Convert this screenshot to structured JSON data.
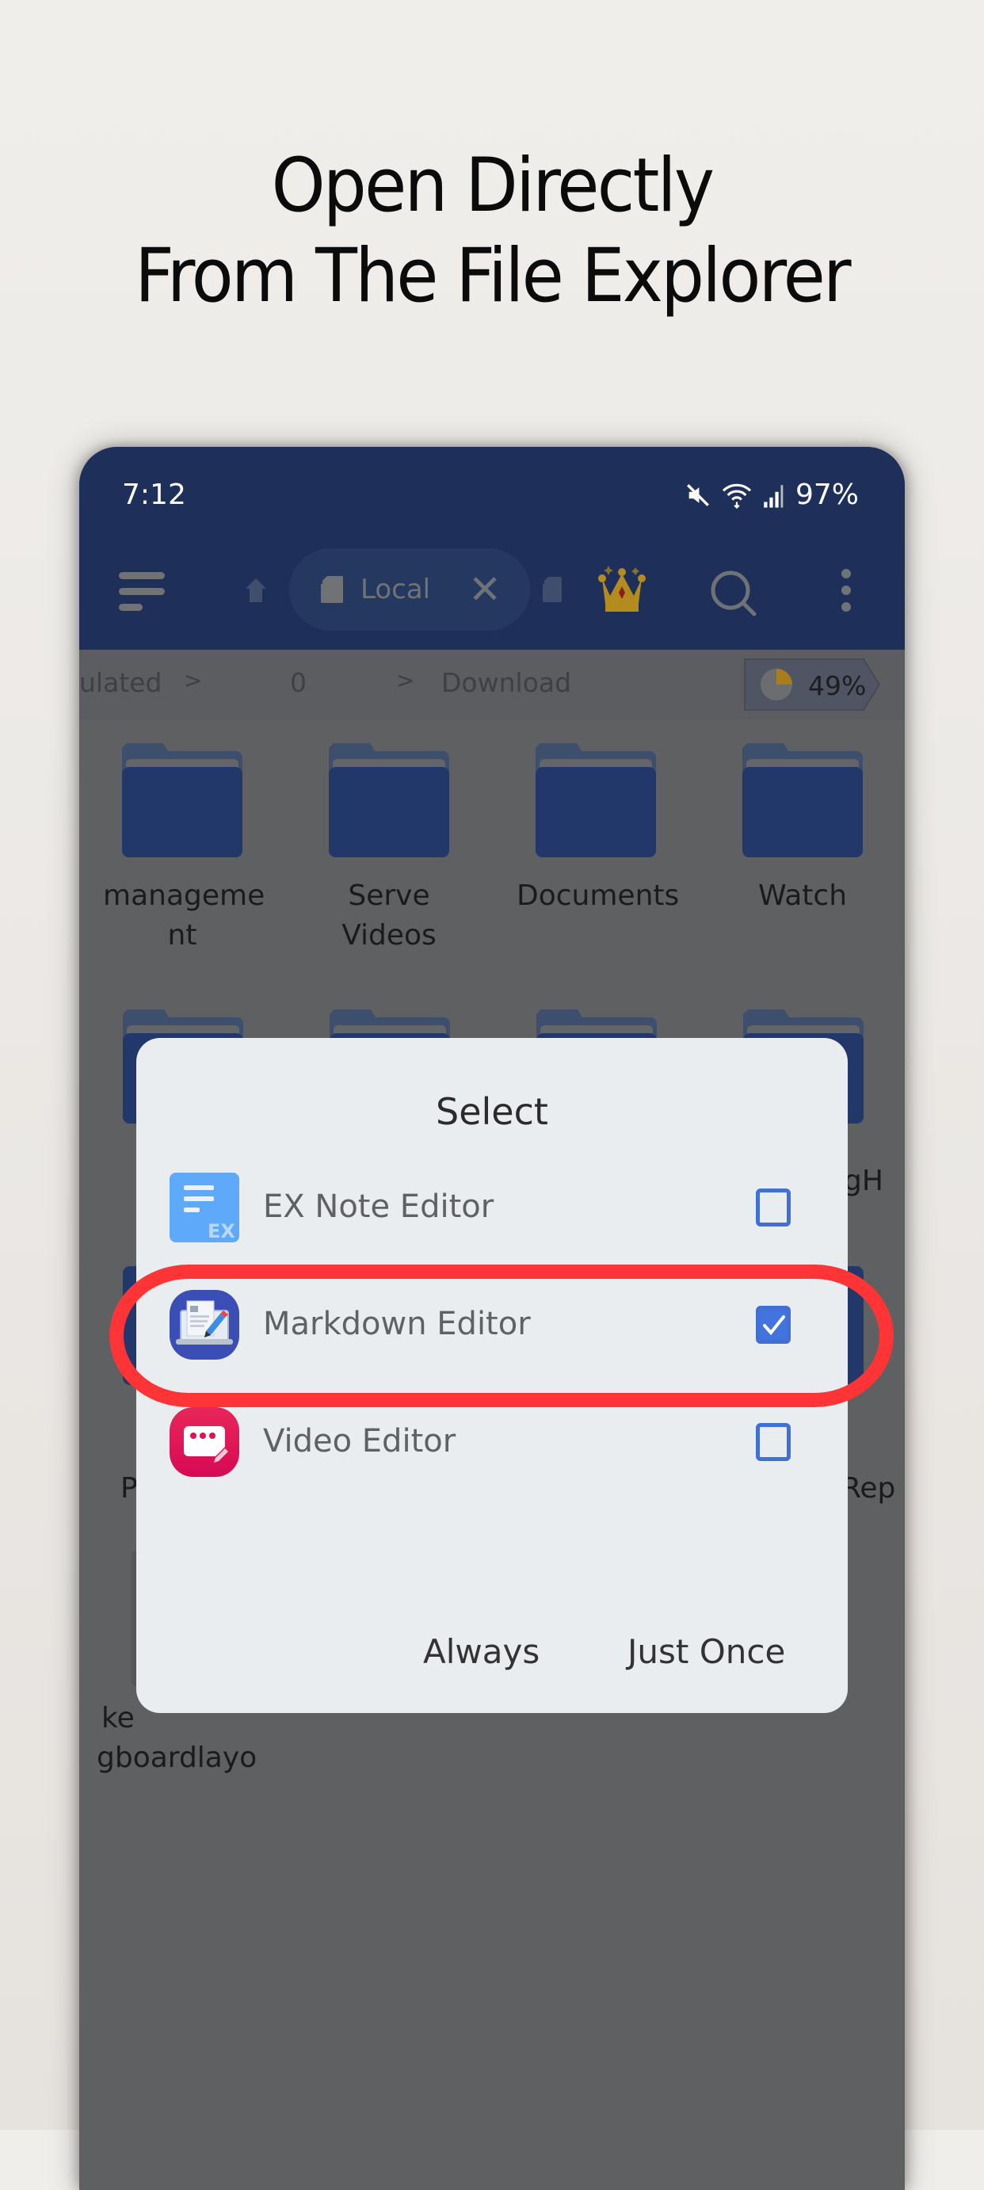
{
  "headline": {
    "line1": "Open Directly",
    "line2": "From The File Explorer"
  },
  "status_bar": {
    "time": "7:12",
    "icons": [
      "mute-icon",
      "wifi-icon",
      "signal-icon"
    ],
    "battery": "97%"
  },
  "toolbar": {
    "menu_icon": "hamburger-menu-icon",
    "home_icon": "home-icon",
    "active_tab_label": "Local",
    "active_tab_icon": "sd-card-icon",
    "close_icon": "close-icon",
    "premium_icon": "crown-icon",
    "search_icon": "search-icon",
    "more_icon": "more-vertical-icon"
  },
  "path_bar": {
    "crumbs": [
      "ulated",
      "0",
      "Download"
    ],
    "separator": ">",
    "storage_percent": "49%",
    "storage_used_fraction": 0.49,
    "accent_color": "#a97d1e"
  },
  "folders": {
    "row1": [
      "manageme\nnt",
      "Serve\nVideos",
      "Documents",
      "Watch"
    ],
    "partial_labels": {
      "right_row2": "gH",
      "left_row3": "P",
      "right_row3": "Rep",
      "left_row4_line1": "ke",
      "left_row4_line2": "gboardlayo"
    },
    "folder_color": "#22376a"
  },
  "dialog": {
    "title": "Select",
    "options": [
      {
        "label": "EX Note Editor",
        "icon": "ex-note-editor-icon",
        "checked": false,
        "icon_color": "#5fa9fb"
      },
      {
        "label": "Markdown Editor",
        "icon": "markdown-editor-icon",
        "checked": true,
        "icon_color": "#3b4eb5"
      },
      {
        "label": "Video Editor",
        "icon": "video-editor-icon",
        "checked": false,
        "icon_color": "#e0134f"
      }
    ],
    "buttons": {
      "always": "Always",
      "just_once": "Just Once"
    },
    "checkbox_color": "#4373dc"
  },
  "highlight_color": "#fe3436"
}
